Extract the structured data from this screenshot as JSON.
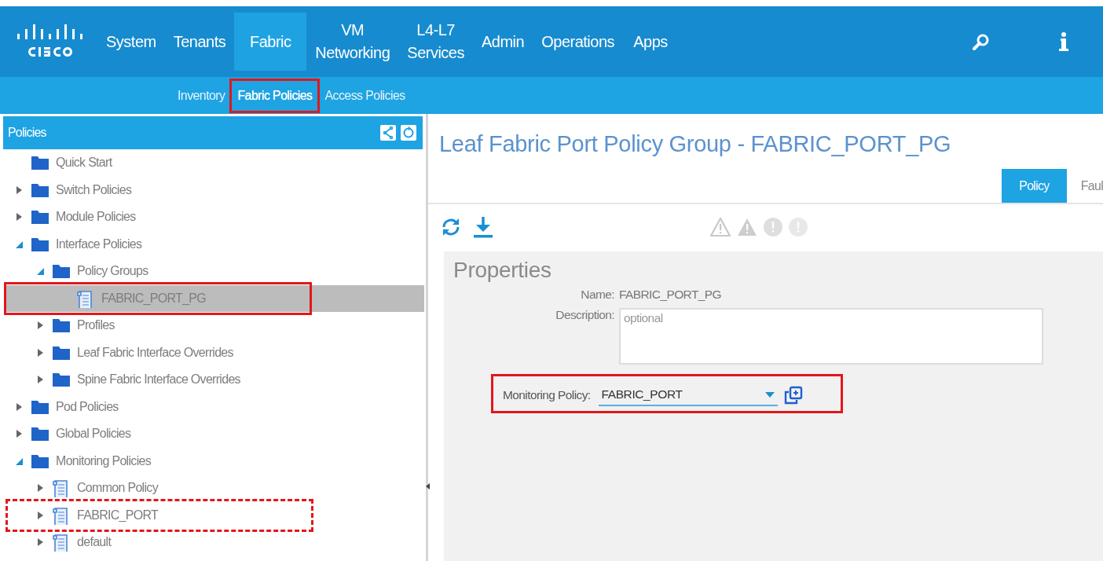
{
  "header": {
    "nav": [
      {
        "label": "System",
        "selected": false
      },
      {
        "label": "Tenants",
        "selected": false
      },
      {
        "label": "Fabric",
        "selected": true
      },
      {
        "label": "VM\nNetworking",
        "selected": false
      },
      {
        "label": "L4-L7\nServices",
        "selected": false
      },
      {
        "label": "Admin",
        "selected": false
      },
      {
        "label": "Operations",
        "selected": false
      },
      {
        "label": "Apps",
        "selected": false
      }
    ]
  },
  "subnav": [
    {
      "label": "Inventory",
      "selected": false,
      "highlighted": false
    },
    {
      "label": "Fabric Policies",
      "selected": true,
      "highlighted": true
    },
    {
      "label": "Access Policies",
      "selected": false,
      "highlighted": false
    }
  ],
  "sidebar": {
    "title": "Policies",
    "items": [
      {
        "label": "Quick Start",
        "kind": "folder",
        "selected": false,
        "highlighted": false
      },
      {
        "label": "Switch Policies",
        "kind": "folder",
        "expanded": false,
        "selected": false,
        "highlighted": false
      },
      {
        "label": "Module Policies",
        "kind": "folder",
        "expanded": false,
        "selected": false,
        "highlighted": false
      },
      {
        "label": "Interface Policies",
        "kind": "folder",
        "expanded": true,
        "selected": false,
        "highlighted": false,
        "children": [
          {
            "label": "Policy Groups",
            "kind": "folder",
            "expanded": true,
            "selected": false,
            "highlighted": false,
            "children": [
              {
                "label": "FABRIC_PORT_PG",
                "kind": "policy",
                "selected": true,
                "highlighted": true
              }
            ]
          },
          {
            "label": "Profiles",
            "kind": "folder",
            "expanded": false,
            "selected": false,
            "highlighted": false
          },
          {
            "label": "Leaf Fabric Interface Overrides",
            "kind": "folder",
            "expanded": false,
            "selected": false,
            "highlighted": false
          },
          {
            "label": "Spine Fabric Interface Overrides",
            "kind": "folder",
            "expanded": false,
            "selected": false,
            "highlighted": false
          }
        ]
      },
      {
        "label": "Pod Policies",
        "kind": "folder",
        "expanded": false,
        "selected": false,
        "highlighted": false
      },
      {
        "label": "Global Policies",
        "kind": "folder",
        "expanded": false,
        "selected": false,
        "highlighted": false
      },
      {
        "label": "Monitoring Policies",
        "kind": "folder",
        "expanded": true,
        "selected": false,
        "highlighted": false,
        "children": [
          {
            "label": "Common Policy",
            "kind": "policy",
            "expanded": false,
            "selected": false,
            "highlighted": false
          },
          {
            "label": "FABRIC_PORT",
            "kind": "policy",
            "expanded": false,
            "selected": false,
            "highlighted": true,
            "dashed": true
          },
          {
            "label": "default",
            "kind": "policy",
            "expanded": false,
            "selected": false,
            "highlighted": false
          }
        ]
      }
    ]
  },
  "content": {
    "title": "Leaf Fabric Port Policy Group - FABRIC_PORT_PG",
    "tabs": [
      {
        "label": "Policy",
        "selected": true
      },
      {
        "label": "Faul",
        "selected": false
      }
    ],
    "properties": {
      "title": "Properties",
      "name": {
        "label": "Name:",
        "value": "FABRIC_PORT_PG"
      },
      "description": {
        "label": "Description:",
        "placeholder": "optional"
      },
      "monitoring_policy": {
        "label": "Monitoring Policy:",
        "value": "FABRIC_PORT",
        "highlighted": true
      }
    }
  }
}
